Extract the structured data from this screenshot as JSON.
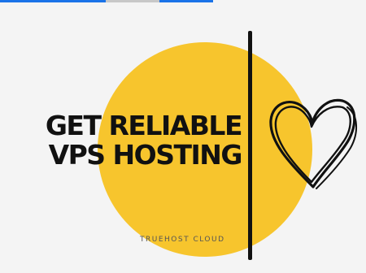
{
  "banner": {
    "headline_line1": "GET RELIABLE",
    "headline_line2": "VPS HOSTING",
    "brand": "TRUEHOST CLOUD",
    "icon": "heart-icon"
  },
  "colors": {
    "background": "#f4f4f4",
    "circle": "#f7c52d",
    "text": "#111111",
    "brand_text": "#555555",
    "strip_blue": "#1a73e8",
    "strip_grey": "#c8c8c8"
  }
}
